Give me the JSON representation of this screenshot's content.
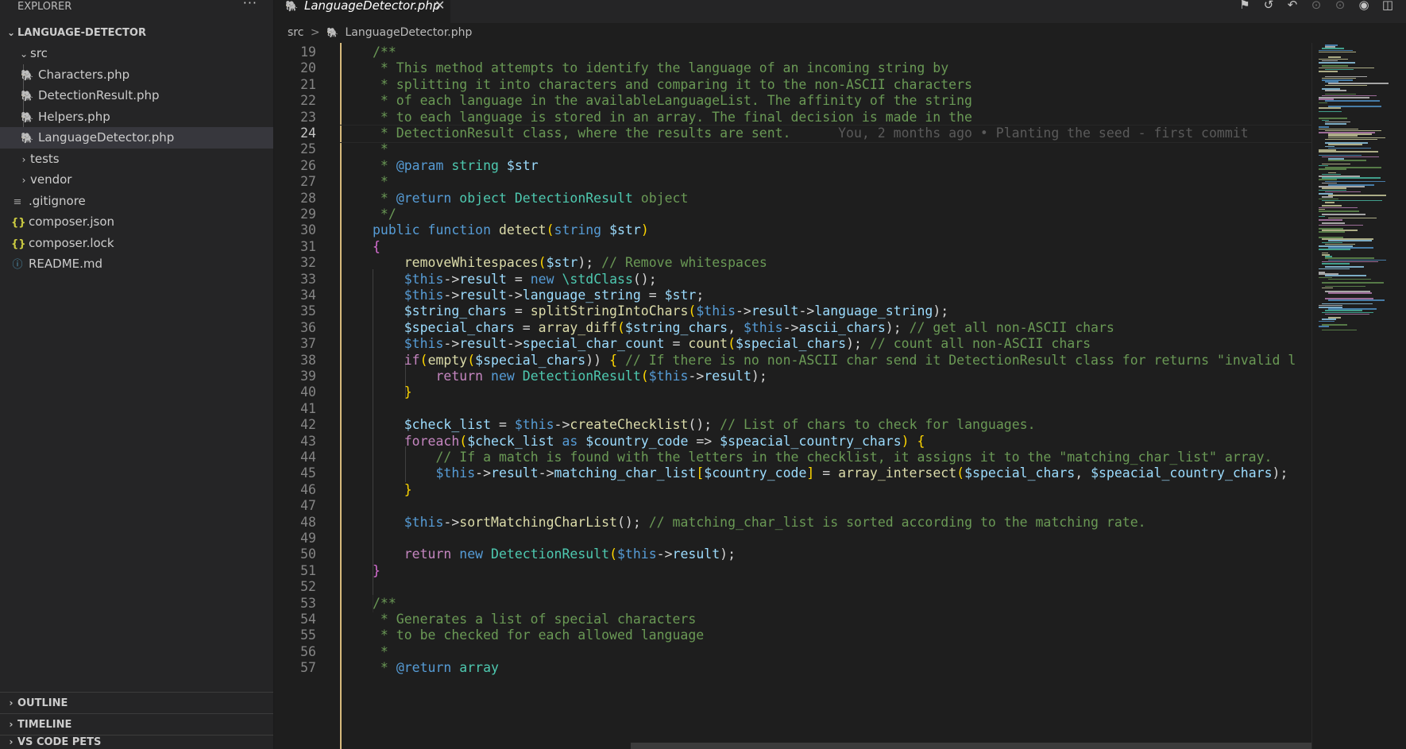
{
  "sidebar": {
    "title": "EXPLORER",
    "more_icon": "ellipsis-icon",
    "project": "LANGUAGE-DETECTOR",
    "folder_src": "src",
    "src_files": [
      "Characters.php",
      "DetectionResult.php",
      "Helpers.php",
      "LanguageDetector.php"
    ],
    "selected_file": "LanguageDetector.php",
    "folders": [
      "tests",
      "vendor"
    ],
    "root_files": [
      ".gitignore",
      "composer.json",
      "composer.lock",
      "README.md"
    ],
    "panels": [
      "OUTLINE",
      "TIMELINE",
      "VS CODE PETS"
    ]
  },
  "tab": {
    "label": "LanguageDetector.php",
    "close": "✕"
  },
  "breadcrumb": {
    "folder": "src",
    "sep": ">",
    "file": "LanguageDetector.php"
  },
  "editor": {
    "current_line": 24,
    "blame": "You, 2 months ago • Planting the seed - first commit",
    "line_numbers": [
      "19",
      "20",
      "21",
      "22",
      "23",
      "24",
      "25",
      "26",
      "27",
      "28",
      "29",
      "30",
      "31",
      "32",
      "33",
      "34",
      "35",
      "36",
      "37",
      "38",
      "39",
      "40",
      "41",
      "42",
      "43",
      "44",
      "45",
      "46",
      "47",
      "48",
      "49",
      "50",
      "51",
      "52",
      "53",
      "54",
      "55",
      "56",
      "57"
    ],
    "lines": [
      "/**",
      " * This method attempts to identify the language of an incoming string by",
      " * splitting it into characters and comparing it to the non-ASCII characters",
      " * of each language in the availableLanguageList. The affinity of the string",
      " * to each language is stored in an array. The final decision is made in the",
      " * DetectionResult class, where the results are sent.",
      " *",
      " * @param string $str",
      " *",
      " * @return object DetectionResult object",
      " */",
      "public function detect(string $str)",
      "{",
      "    removeWhitespaces($str); // Remove whitespaces",
      "    $this->result = new \\stdClass();",
      "    $this->result->language_string = $str;",
      "    $string_chars = splitStringIntoChars($this->result->language_string);",
      "    $special_chars = array_diff($string_chars, $this->ascii_chars); // get all non-ASCII chars",
      "    $this->result->special_char_count = count($special_chars); // count all non-ASCII chars",
      "    if(empty($special_chars)) { // If there is no non-ASCII char send it DetectionResult class for returns \"invalid l",
      "        return new DetectionResult($this->result);",
      "    }",
      "",
      "    $check_list = $this->createChecklist(); // List of chars to check for languages.",
      "    foreach($check_list as $country_code => $speacial_country_chars) {",
      "        // If a match is found with the letters in the checklist, it assigns it to the \"matching_char_list\" array.",
      "        $this->result->matching_char_list[$country_code] = array_intersect($special_chars, $speacial_country_chars);",
      "    }",
      "",
      "    $this->sortMatchingCharList(); // matching_char_list is sorted according to the matching rate.",
      "",
      "    return new DetectionResult($this->result);",
      "}",
      "",
      "/**",
      " * Generates a list of special characters",
      " * to be checked for each allowed language",
      " *",
      " * @return array"
    ]
  },
  "colors": {
    "background": "#1e1e1e",
    "sidebar": "#252526",
    "comment": "#6a9955",
    "keyword": "#569cd6",
    "function": "#dcdcaa",
    "variable": "#9cdcfe",
    "type": "#4ec9b0",
    "git_modified": "#d7ba7d"
  }
}
